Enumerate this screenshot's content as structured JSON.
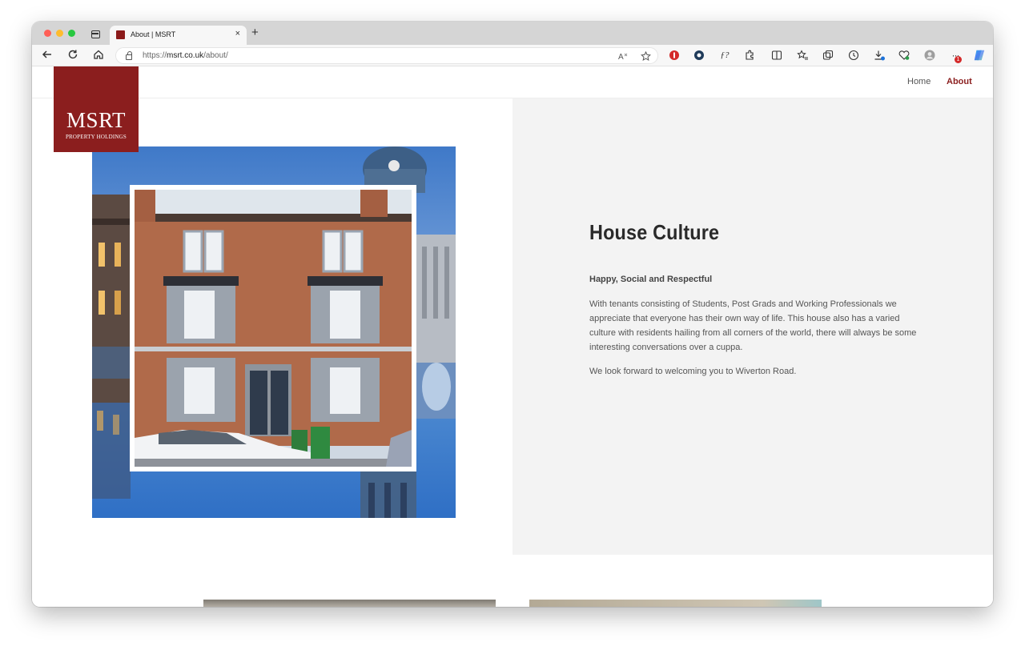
{
  "browser": {
    "tab_title": "About | MSRT",
    "tab_close": "×",
    "new_tab": "+",
    "url_scheme": "https://",
    "url_host": "msrt.co.uk",
    "url_path": "/about/",
    "nav_icons": [
      "back-icon",
      "reload-icon",
      "home-icon"
    ],
    "extension_badge": "1"
  },
  "site": {
    "logo_main": "MSRT",
    "logo_sub": "PROPERTY HOLDINGS",
    "nav": [
      {
        "label": "Home",
        "active": false
      },
      {
        "label": "About",
        "active": true
      }
    ],
    "accent_color": "#8b1e1e"
  },
  "content": {
    "heading": "House Culture",
    "subheading": "Happy, Social and Respectful",
    "paragraph_1": "With tenants consisting of Students, Post Grads and Working Professionals we appreciate that everyone has their own way of life. This house also has a varied culture with residents hailing from all corners of the world, there will always be some interesting conversations over a cuppa.",
    "paragraph_2": "We look forward to welcoming you to Wiverton Road."
  }
}
